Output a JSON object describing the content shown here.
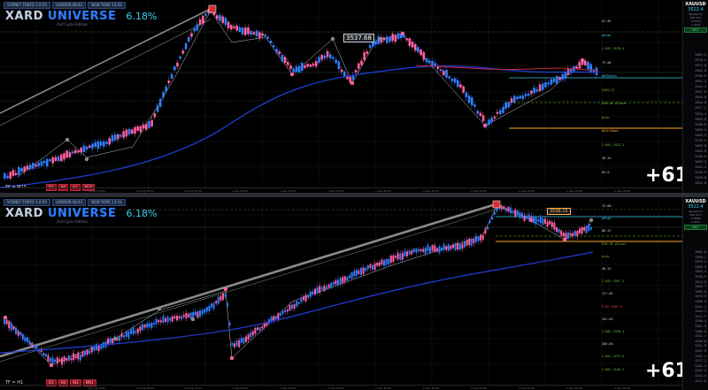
{
  "session_tabs": [
    "SYDNEY TOKYO 1-0:45",
    "LONDON 08:43",
    "NEW YORK 13:43"
  ],
  "brand": {
    "logo_part1": "XARD ",
    "logo_part2": "UNIVERSE",
    "percent": "6.18%",
    "subtitle": "2nd Cycle Edition"
  },
  "colors": {
    "bull": "#2f7dff",
    "bear": "#ff5fa2",
    "ma_blue": "#1f3fd8",
    "ma_red": "#c2253a",
    "trend_gray": "#8a8a8a",
    "level_green": "#6cbf3a",
    "level_orange": "#ffa726",
    "level_cyan": "#38c4e0",
    "level_olive": "#9a9a3a"
  },
  "top": {
    "timeframe_label": "TF = M15",
    "badges": [
      "D1",
      "H4",
      "H1",
      "M30"
    ],
    "big_number": "+61",
    "bubble_price": "3537.68",
    "info": {
      "symbol": "XAUUSD",
      "price": "3522.4",
      "lines": [
        "Spread 12",
        "ATR 24.1",
        "H 3578",
        "L 3479"
      ],
      "chip": "BUY"
    },
    "level_tags": [
      {
        "text": "61.85",
        "color": "#cfd3dc"
      },
      {
        "text": "pHigh",
        "color": "#38c4e0"
      },
      {
        "text": "2.88% 3578.4",
        "color": "#6cbf3a"
      },
      {
        "text": "75.00",
        "color": "#cfd3dc"
      },
      {
        "text": "WEEKOpen",
        "color": "#38c4e0"
      },
      {
        "text": "3466.57",
        "color": "#9a9a3a"
      },
      {
        "text": "DYN 38 pClose",
        "color": "#6cbf3a"
      },
      {
        "text": "pLow",
        "color": "#6cbf3a"
      },
      {
        "text": "DAILYOpen",
        "color": "#ffa726"
      },
      {
        "text": "2.88% 3432.1",
        "color": "#6cbf3a"
      },
      {
        "text": "38.25",
        "color": "#cfd3dc"
      },
      {
        "text": "85.0",
        "color": "#cfd3dc"
      }
    ],
    "axis_ticks": [
      "3585.2",
      "3578.4",
      "3571.6",
      "3564.8",
      "3558.0",
      "3551.2",
      "3544.4",
      "3537.6",
      "3530.8",
      "3524.0",
      "3517.2",
      "3510.4",
      "3503.6",
      "3496.8",
      "3490.0",
      "3483.2",
      "3476.4",
      "3469.6",
      "3462.8",
      "3456.0",
      "3449.2",
      "3442.4",
      "3435.6",
      "3428.8",
      "3422.0"
    ]
  },
  "bottom": {
    "timeframe_label": "TF = H1",
    "badges": [
      "D1",
      "H4",
      "W1",
      "MN1"
    ],
    "big_number": "+61",
    "bubble_price": "3598.15",
    "info": {
      "symbol": "XAUUSD",
      "price": "3522.4",
      "lines": [
        "Spread 12",
        "ATR 31.7",
        "H 3598",
        "L 3311"
      ],
      "chip": "BUY"
    },
    "level_tags": [
      {
        "text": "75.00",
        "color": "#cfd3dc"
      },
      {
        "text": "pHigh",
        "color": "#38c4e0"
      },
      {
        "text": "88.25",
        "color": "#cfd3dc"
      },
      {
        "text": "DYN 38 pClose",
        "color": "#6cbf3a"
      },
      {
        "text": "pLow",
        "color": "#6cbf3a"
      },
      {
        "text": "38.25",
        "color": "#cfd3dc"
      },
      {
        "text": "2.88% 3397.1",
        "color": "#6cbf3a"
      },
      {
        "text": "127.85",
        "color": "#cfd3dc"
      },
      {
        "text": "5.8% 3357.5",
        "color": "#ff4d4d"
      },
      {
        "text": "161.85",
        "color": "#cfd3dc"
      },
      {
        "text": "2.88% 3318.4",
        "color": "#6cbf3a"
      },
      {
        "text": "200.85",
        "color": "#cfd3dc"
      },
      {
        "text": "2.88% 3279.6",
        "color": "#6cbf3a"
      },
      {
        "text": "2.88% 3240.7",
        "color": "#6cbf3a"
      }
    ],
    "axis_ticks": [
      "3605.0",
      "3590.1",
      "3575.2",
      "3560.3",
      "3545.4",
      "3530.5",
      "3515.6",
      "3500.7",
      "3485.8",
      "3470.9",
      "3456.0",
      "3441.1",
      "3426.2",
      "3411.3",
      "3396.4",
      "3381.5",
      "3366.6",
      "3351.7",
      "3336.8",
      "3321.9",
      "3307.0",
      "3292.1",
      "3277.2",
      "3262.3",
      "3247.4",
      "3232.5",
      "3217.6"
    ]
  },
  "time_ticks": [
    "28 Aug 2025",
    "29 Aug 06:00",
    "29 Aug 14:00",
    "1 Sep 08:00",
    "1 Sep 16:00",
    "2 Sep 02:00",
    "2 Sep 10:00",
    "2 Sep 18:00",
    "3 Sep 04:00",
    "3 Sep 12:00",
    "3 Sep 20:00",
    "4 Sep 06:00"
  ]
}
